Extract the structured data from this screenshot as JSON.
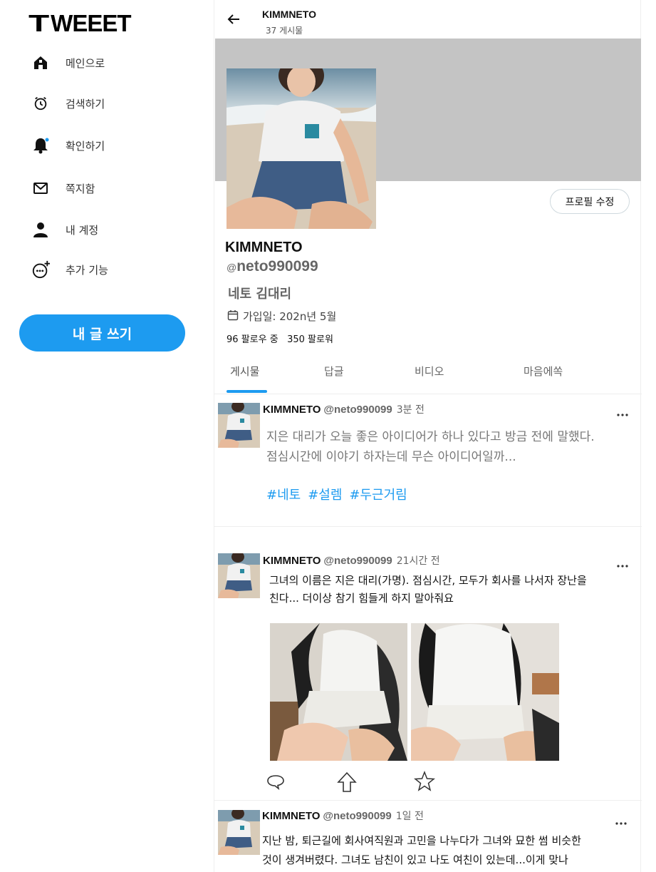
{
  "app": {
    "logo_text": "WEEET",
    "logo_initial": "T"
  },
  "sidebar": {
    "items": [
      {
        "label": "메인으로",
        "icon": "home-icon"
      },
      {
        "label": "검색하기",
        "icon": "clock-icon"
      },
      {
        "label": "확인하기",
        "icon": "bell-icon"
      },
      {
        "label": "쪽지함",
        "icon": "envelope-icon"
      },
      {
        "label": "내 계정",
        "icon": "person-icon"
      },
      {
        "label": "추가 기능",
        "icon": "more-plus-icon"
      }
    ],
    "write_button": "내 글 쓰기"
  },
  "header": {
    "title": "KIMMNETO",
    "post_count": "37 게시물",
    "back_icon": "arrow-left-icon"
  },
  "profile": {
    "banner_color": "#c4c4c4",
    "edit_button": "프로필 수정",
    "name": "KIMMNETO",
    "handle_at": "@",
    "handle": "neto990099",
    "alias": "네토 김대리",
    "joined": "가입일: 202n년 5월",
    "following_count": "96",
    "following_label": "팔로우 중",
    "followers_count": "350",
    "followers_label": "팔로워"
  },
  "tabs": [
    {
      "label": "게시물",
      "active": true
    },
    {
      "label": "답글"
    },
    {
      "label": "비디오"
    },
    {
      "label": "마음에쏙"
    }
  ],
  "posts": [
    {
      "name": "KIMMNETO",
      "handle": "@neto990099",
      "time": "3분 전",
      "text_line1": "지은 대리가 오늘 좋은 아이디어가 하나 있다고 방금 전에 말했다.",
      "text_line2": "점심시간에 이야기 하자는데 무슨 아이디어일까...",
      "hashtags": [
        "#네토",
        "#설렘",
        "#두근거림"
      ]
    },
    {
      "name": "KIMMNETO",
      "handle": "@neto990099",
      "time": "21시간 전",
      "text_line1": "그녀의 이름은 지은 대리(가명). 점심시간, 모두가 회사를 나서자 장난을",
      "text_line2": "친다... 더이상 참기 힘들게 하지 말아줘요"
    },
    {
      "name": "KIMMNETO",
      "handle": "@neto990099",
      "time": "1일 전",
      "text_line1": "지난 밤, 퇴근길에 회사여직원과 고민을 나누다가 그녀와 묘한 썸 비슷한",
      "text_line2": "것이 생겨버렸다. 그녀도 남친이 있고 나도 여친이 있는데...이게 맞나"
    }
  ],
  "colors": {
    "accent": "#1d9bf0",
    "banner": "#c4c4c4"
  }
}
